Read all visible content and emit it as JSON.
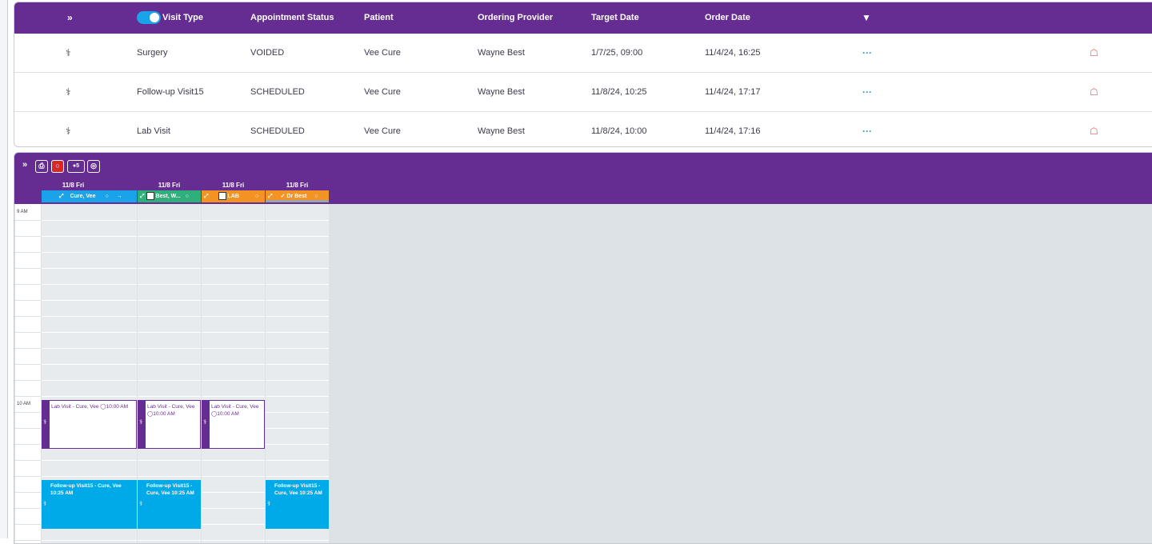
{
  "orders": {
    "headers": {
      "visit_type": "Visit Type",
      "appointment_status": "Appointment Status",
      "patient": "Patient",
      "ordering_provider": "Ordering Provider",
      "target_date": "Target Date",
      "order_date": "Order Date"
    },
    "rows": [
      {
        "visit_type": "Surgery",
        "status": "VOIDED",
        "patient": "Vee Cure",
        "provider": "Wayne Best",
        "target": "1/7/25, 09:00",
        "order": "11/4/24, 16:25"
      },
      {
        "visit_type": "Follow-up Visit15",
        "status": "SCHEDULED",
        "patient": "Vee Cure",
        "provider": "Wayne Best",
        "target": "11/8/24, 10:25",
        "order": "11/4/24, 17:17"
      },
      {
        "visit_type": "Lab Visit",
        "status": "SCHEDULED",
        "patient": "Vee Cure",
        "provider": "Wayne Best",
        "target": "11/8/24, 10:00",
        "order": "11/4/24, 17:16"
      }
    ],
    "more_label": "···",
    "icons": {
      "collapse": "double-chevron-down-icon",
      "filter": "filter-icon",
      "row": "stethoscope-icon",
      "delete": "trash-icon"
    }
  },
  "calendar": {
    "toolbar_badge": "5",
    "day_headers": [
      "11/8 Fri",
      "11/8 Fri",
      "11/8 Fri",
      "11/8 Fri"
    ],
    "columns": [
      {
        "label": "Cure, Vee",
        "color": "#1aa3e8"
      },
      {
        "label": "Best, W...",
        "color": "#2fb07a"
      },
      {
        "label": "LAB",
        "color": "#f39323"
      },
      {
        "label": "Dr Best",
        "color": "#f39323"
      }
    ],
    "time_labels": {
      "nine": "9 AM",
      "ten": "10 AM"
    },
    "events_lab": [
      "Lab Visit - Cure, Vee ◯10:00 AM",
      "Lab Visit - Cure, Vee ◯10:00 AM",
      "Lab Visit - Cure, Vee ◯10:00 AM"
    ],
    "events_followup": [
      "Follow-up Visit15 - Cure, Vee 10:25 AM",
      "Follow-up Visit15 - Cure, Vee 10:25 AM",
      "Follow-up Visit15 - Cure, Vee 10:25 AM"
    ]
  }
}
